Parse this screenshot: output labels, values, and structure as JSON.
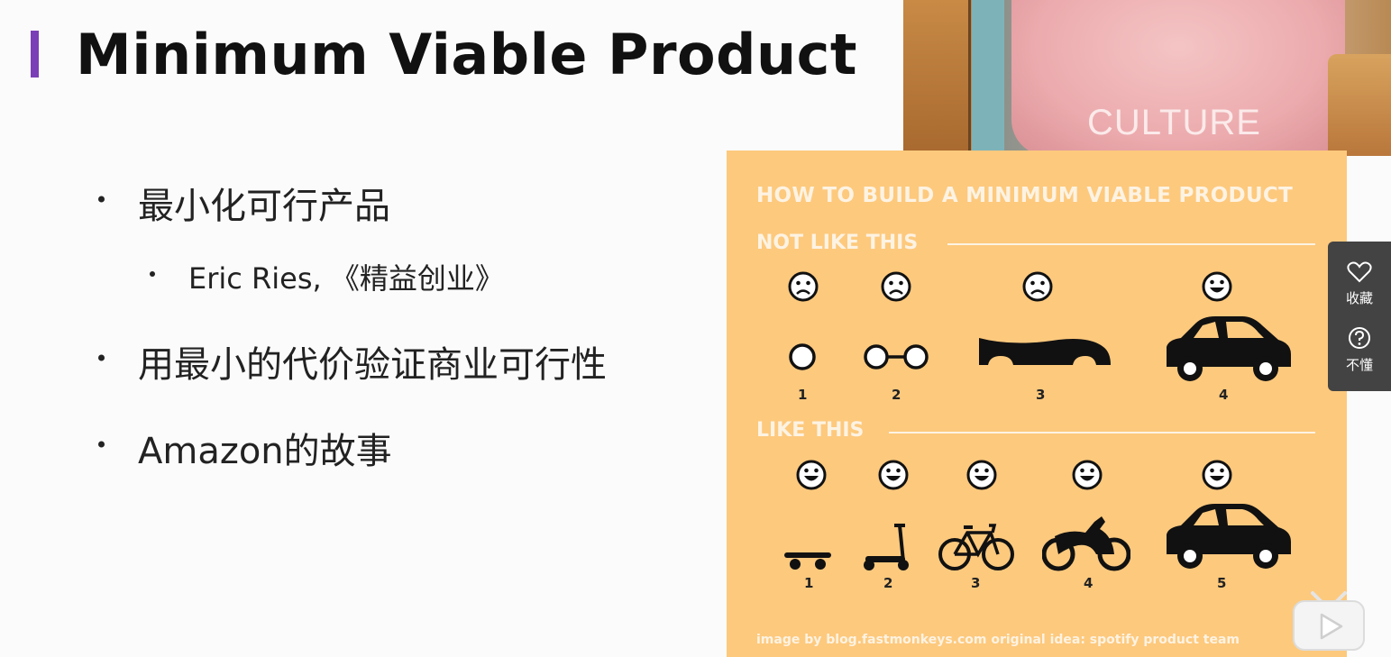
{
  "slide": {
    "title": "Minimum Viable Product",
    "bullets": [
      "最小化可行产品",
      "Eric Ries, 《精益创业》",
      "用最小的代价验证商业可行性",
      "Amazon的故事"
    ]
  },
  "webcam": {
    "shirt_text": "CULTURE"
  },
  "mvp_image": {
    "heading": "HOW TO BUILD A MINIMUM VIABLE PRODUCT",
    "not_like_this": "NOT LIKE THIS",
    "like_this": "LIKE THIS",
    "row1_numbers": [
      "1",
      "2",
      "3",
      "4"
    ],
    "row2_numbers": [
      "1",
      "2",
      "3",
      "4",
      "5"
    ],
    "credit": "image by blog.fastmonkeys.com  original idea: spotify product team"
  },
  "side_panel": {
    "favorite_label": "收藏",
    "help_label": "不懂"
  },
  "colors": {
    "accent": "#7a3fb6",
    "image_bg": "#fdc97d",
    "panel_bg": "#434343"
  }
}
